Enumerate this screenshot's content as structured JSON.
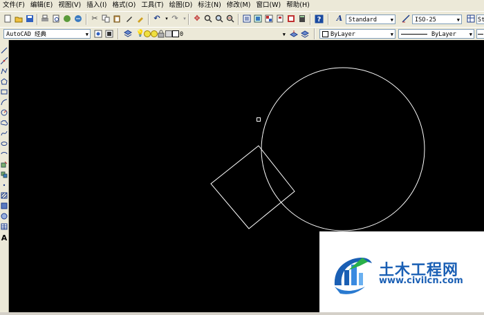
{
  "menubar": {
    "items": [
      {
        "label": "文件(F)"
      },
      {
        "label": "编辑(E)"
      },
      {
        "label": "视图(V)"
      },
      {
        "label": "插入(I)"
      },
      {
        "label": "格式(O)"
      },
      {
        "label": "工具(T)"
      },
      {
        "label": "绘图(D)"
      },
      {
        "label": "标注(N)"
      },
      {
        "label": "修改(M)"
      },
      {
        "label": "窗口(W)"
      },
      {
        "label": "帮助(H)"
      }
    ]
  },
  "toolbar": {
    "text_style": "Standard",
    "dim_style": "ISO-25",
    "truncated_style": "St",
    "workspace": "AutoCAD 经典",
    "layer": "0",
    "color": "ByLayer",
    "linetype": "ByLayer"
  },
  "left_toolbar": {
    "text_tool_glyph": "A"
  },
  "watermark": {
    "name": "土木工程网",
    "url": "www.civilcn.com"
  },
  "colors": {
    "canvas": "#000000",
    "geometry": "#ffffff",
    "logo_blue": "#1a5fb4",
    "ui_face": "#ece9d8"
  }
}
